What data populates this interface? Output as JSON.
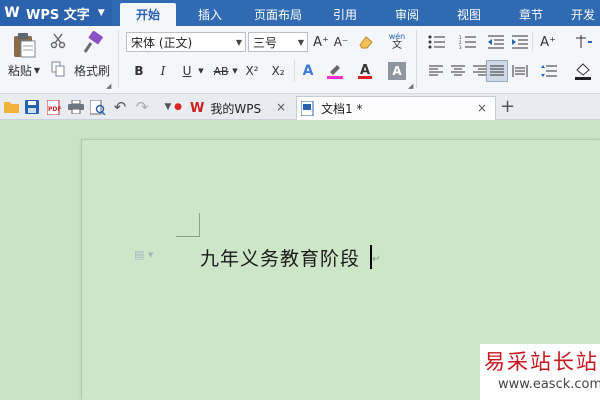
{
  "app": {
    "title": "WPS 文字",
    "logo": "W"
  },
  "ribbon_tabs": [
    {
      "label": "开始",
      "active": true
    },
    {
      "label": "插入"
    },
    {
      "label": "页面布局"
    },
    {
      "label": "引用"
    },
    {
      "label": "审阅"
    },
    {
      "label": "视图"
    },
    {
      "label": "章节"
    },
    {
      "label": "开发"
    }
  ],
  "clipboard": {
    "paste_label": "粘贴",
    "format_painter_label": "格式刷"
  },
  "font": {
    "family": "宋体 (正文)",
    "size": "三号"
  },
  "font_buttons": {
    "bold": "B",
    "italic": "I",
    "underline": "U",
    "strike": "AB",
    "superscript": "X²",
    "subscript": "X₂",
    "pinyin": "wén\n文"
  },
  "doc_tabs": [
    {
      "label": "我的WPS",
      "active": false
    },
    {
      "label": "文档1 *",
      "active": true
    }
  ],
  "document": {
    "text": "九年义务教育阶段"
  },
  "watermark": {
    "text": "易采站长站",
    "url": "www.easck.com"
  },
  "colors": {
    "ribbon_blue": "#2f6ab3",
    "ribbon_bg": "#f4f6f9",
    "page_green": "#cde6c8",
    "accent_red": "#c8181f"
  }
}
